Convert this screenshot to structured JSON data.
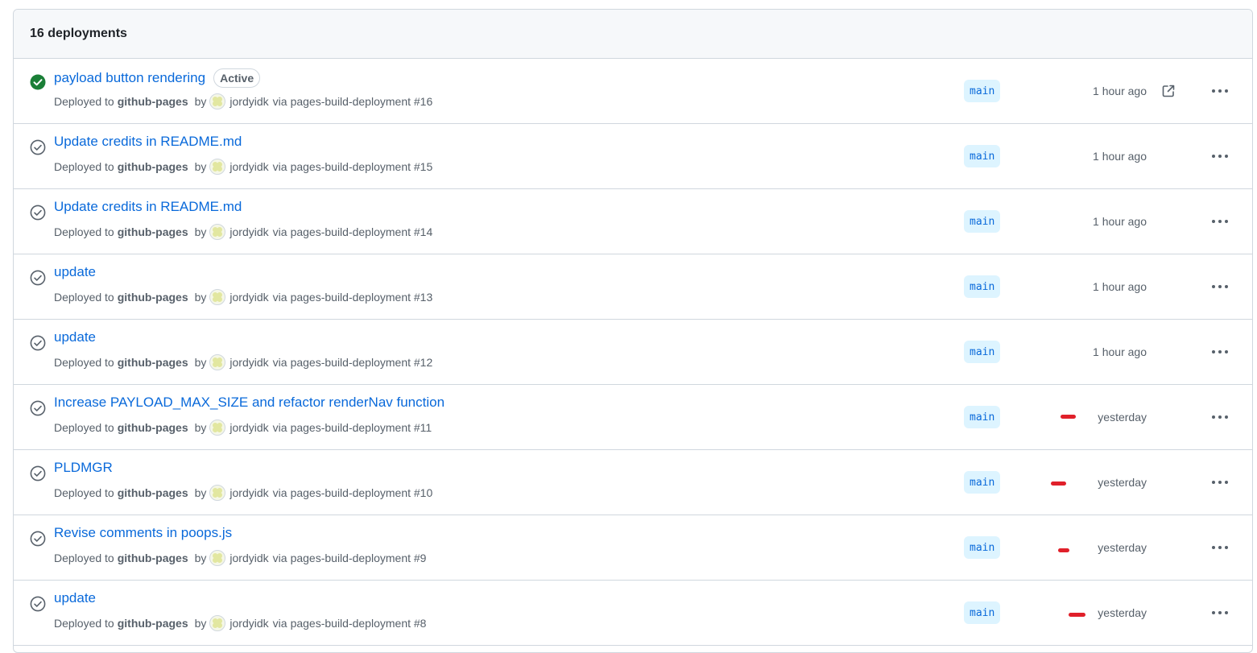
{
  "header": {
    "title": "16 deployments"
  },
  "colors": {
    "success": "#1a7f37",
    "link": "#0969da",
    "muted": "#57606a",
    "branch_bg": "#ddf4ff",
    "redaction": "#e0202a"
  },
  "labels": {
    "deployed_to": "Deployed to",
    "by": "by",
    "via": "via"
  },
  "rows": [
    {
      "title": "payload button rendering",
      "badge": "Active",
      "status": "success",
      "environment": "github-pages",
      "user": "jordyidk",
      "workflow": "pages-build-deployment #16",
      "branch": "main",
      "time": "1 hour ago",
      "has_external_link": true,
      "icon": "check-circle-fill-icon"
    },
    {
      "title": "Update credits in README.md",
      "status": "inactive",
      "environment": "github-pages",
      "user": "jordyidk",
      "workflow": "pages-build-deployment #15",
      "branch": "main",
      "time": "1 hour ago",
      "icon": "check-circle-icon"
    },
    {
      "title": "Update credits in README.md",
      "status": "inactive",
      "environment": "github-pages",
      "user": "jordyidk",
      "workflow": "pages-build-deployment #14",
      "branch": "main",
      "time": "1 hour ago",
      "icon": "check-circle-icon"
    },
    {
      "title": "update",
      "status": "inactive",
      "environment": "github-pages",
      "user": "jordyidk",
      "workflow": "pages-build-deployment #13",
      "branch": "main",
      "time": "1 hour ago",
      "icon": "check-circle-icon"
    },
    {
      "title": "update",
      "status": "inactive",
      "environment": "github-pages",
      "user": "jordyidk",
      "workflow": "pages-build-deployment #12",
      "branch": "main",
      "time": "1 hour ago",
      "icon": "check-circle-icon"
    },
    {
      "title": "Increase PAYLOAD_MAX_SIZE and refactor renderNav function",
      "status": "inactive",
      "environment": "github-pages",
      "user": "jordyidk",
      "workflow": "pages-build-deployment #11",
      "branch": "main",
      "time": "yesterday",
      "icon": "check-circle-icon",
      "redaction": true
    },
    {
      "title": "PLDMGR",
      "status": "inactive",
      "environment": "github-pages",
      "user": "jordyidk",
      "workflow": "pages-build-deployment #10",
      "branch": "main",
      "time": "yesterday",
      "icon": "check-circle-icon",
      "redaction": true
    },
    {
      "title": "Revise comments in poops.js",
      "status": "inactive",
      "environment": "github-pages",
      "user": "jordyidk",
      "workflow": "pages-build-deployment #9",
      "branch": "main",
      "time": "yesterday",
      "icon": "check-circle-icon",
      "redaction": true
    },
    {
      "title": "update",
      "status": "inactive",
      "environment": "github-pages",
      "user": "jordyidk",
      "workflow": "pages-build-deployment #8",
      "branch": "main",
      "time": "yesterday",
      "icon": "check-circle-icon",
      "redaction": true
    }
  ]
}
